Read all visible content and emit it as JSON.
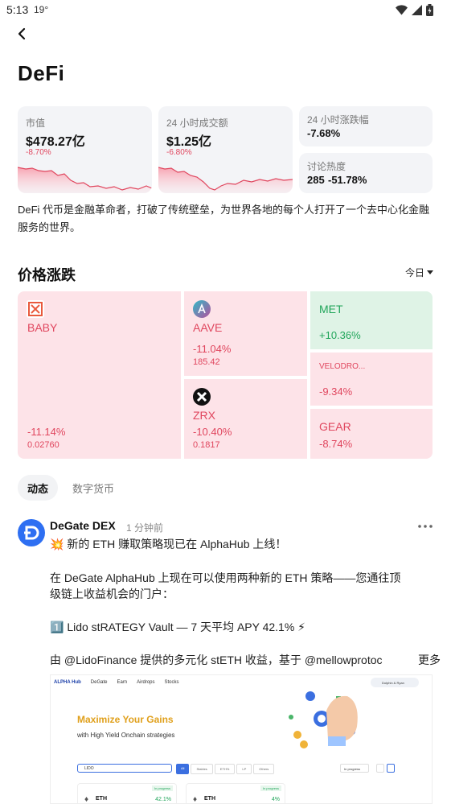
{
  "status_bar": {
    "time": "5:13",
    "temp": "19°"
  },
  "page": {
    "title": "DeFi"
  },
  "stats": {
    "market_cap": {
      "label": "市值",
      "value": "$478.27亿",
      "change": "-8.70%"
    },
    "volume_24h": {
      "label": "24 小时成交额",
      "value": "$1.25亿",
      "change": "-6.80%"
    },
    "change_24h": {
      "label": "24 小时涨跌幅",
      "value": "-7.68%"
    },
    "discussion": {
      "label": "讨论热度",
      "value": "285",
      "change": "-51.78%"
    }
  },
  "description": "DeFi 代币是金融革命者，打破了传统壁垒，为世界各地的每个人打开了一个去中心化金融服务的世界。",
  "price_section": {
    "title": "价格涨跌",
    "period": "今日"
  },
  "tiles": [
    {
      "name": "BABY",
      "change": "-11.14%",
      "price": "0.02760",
      "icon": "baby-logo"
    },
    {
      "name": "AAVE",
      "change": "-11.04%",
      "price": "185.42",
      "icon": "aave-logo"
    },
    {
      "name": "ZRX",
      "change": "-10.40%",
      "price": "0.1817",
      "icon": "zrx-logo"
    },
    {
      "name": "MET",
      "change": "+10.36%"
    },
    {
      "name": "VELODRO...",
      "change": "-9.34%"
    },
    {
      "name": "GEAR",
      "change": "-8.74%"
    }
  ],
  "colors": {
    "down": "#e0465e",
    "down_bg": "#fde3e8",
    "up": "#21a55a",
    "up_bg": "#dff3e6"
  },
  "tabs": [
    "动态",
    "数字货币"
  ],
  "post": {
    "author": "DeGate DEX",
    "time_ago": "1 分钟前",
    "lines": [
      "💥 新的 ETH 赚取策略现已在 AlphaHub 上线！",
      "在 DeGate AlphaHub 上现在可以使用两种新的 ETH 策略——您通往顶",
      "级链上收益机会的门户：",
      "1️⃣ Lido stRATEGY Vault — 7 天平均 APY 42.1% ⚡",
      "由 @LidoFinance 提供的多元化 stETH 收益，基于 @mellowprotoc"
    ],
    "read_more": "更多",
    "image": {
      "nav": [
        "ALPHA Hub",
        "DeGate",
        "Earn",
        "Airdrops",
        "Stocks"
      ],
      "badge": "Dolphin & Ryan",
      "headline": "Maximize Your Gains",
      "subheadline": "with High Yield Onchain strategies",
      "search": "LIDO",
      "filters": [
        "All",
        "Stables",
        "ETH%",
        "LP",
        "Others"
      ],
      "status_select": "In progress",
      "rows": [
        {
          "asset": "ETH",
          "status": "In progress",
          "apy": "42.1%"
        },
        {
          "asset": "ETH",
          "status": "In progress",
          "apy": "4%"
        }
      ]
    }
  }
}
